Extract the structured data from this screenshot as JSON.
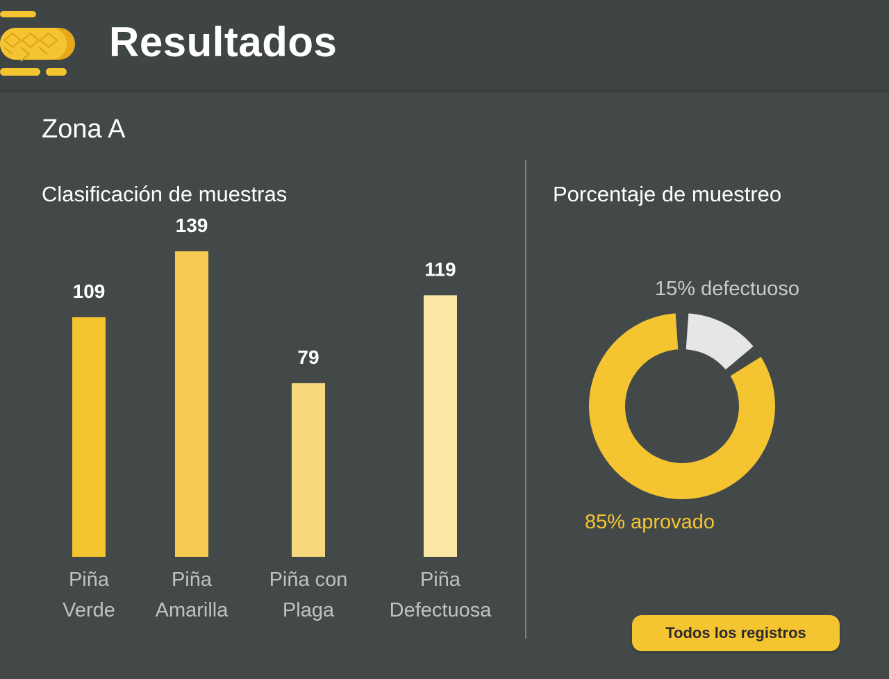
{
  "header": {
    "title": "Resultados",
    "logo_icon": "pineapple-slices-logo"
  },
  "zone": {
    "title": "Zona A"
  },
  "left_panel": {
    "title": "Clasificación de muestras"
  },
  "right_panel": {
    "title": "Porcentaje de muestreo",
    "legend_defective": "15% defectuoso",
    "legend_approved": "85% aprovado"
  },
  "actions": {
    "all_records_label": "Todos los registros"
  },
  "colors": {
    "background": "#434949",
    "accent": "#f5c431",
    "defective_slice": "#e6e6e6"
  },
  "chart_data": [
    {
      "type": "bar",
      "categories": [
        [
          "Piña",
          "Verde"
        ],
        [
          "Piña",
          "Amarilla"
        ],
        [
          "Piña con",
          "Plaga"
        ],
        [
          "Piña",
          "Defectuosa"
        ]
      ],
      "values": [
        109,
        139,
        79,
        119
      ],
      "colors": [
        "#f5c431",
        "#f7cb52",
        "#f8d87d",
        "#fbe6a5"
      ],
      "title": "Clasificación de muestras",
      "ylim": [
        0,
        139
      ],
      "grid": false
    },
    {
      "type": "pie",
      "donut": true,
      "labels": [
        "defectuoso",
        "aprovado"
      ],
      "values": [
        15,
        85
      ],
      "colors": [
        "#e6e6e6",
        "#f5c431"
      ],
      "title": "Porcentaje de muestreo"
    }
  ]
}
